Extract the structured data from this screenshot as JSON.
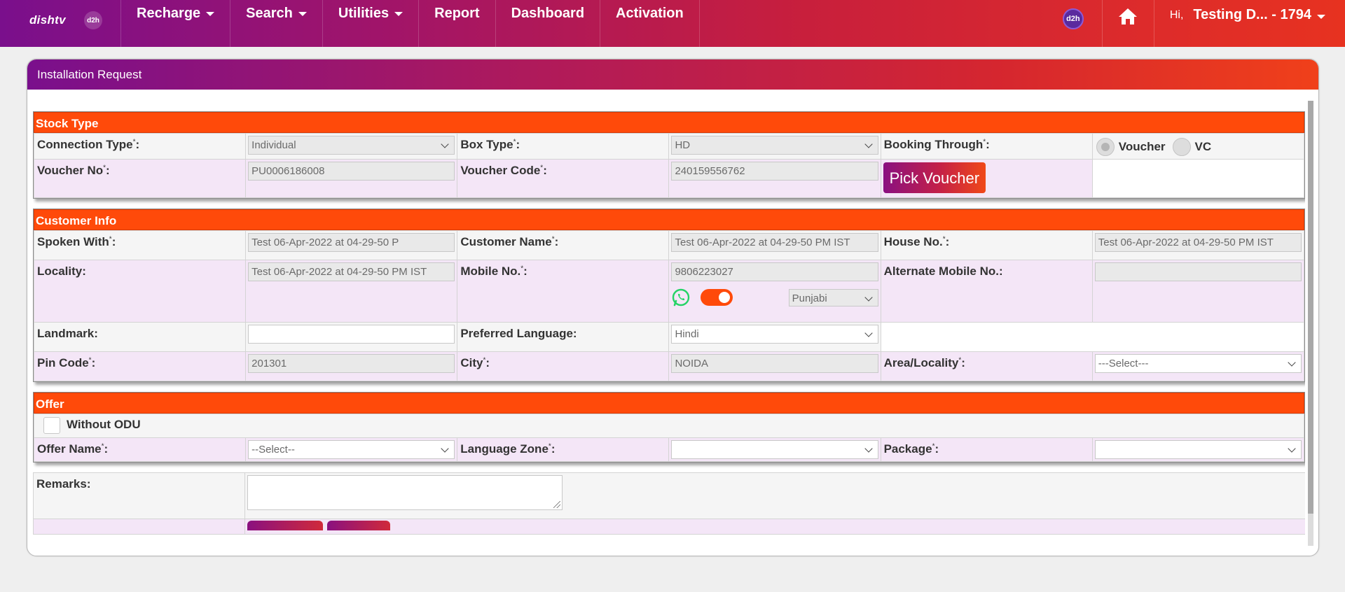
{
  "brand": {
    "logo_text": "dishtv",
    "d2h_logo_text": "d2h"
  },
  "nav": {
    "items": [
      {
        "label": "Recharge",
        "dropdown": true
      },
      {
        "label": "Search",
        "dropdown": true
      },
      {
        "label": "Utilities",
        "dropdown": true
      },
      {
        "label": "Report",
        "dropdown": false
      },
      {
        "label": "Dashboard",
        "dropdown": false
      },
      {
        "label": "Activation",
        "dropdown": false
      }
    ],
    "d2h_badge": "d2h",
    "greeting": "Hi,",
    "user_name": "Testing D... - 1794"
  },
  "panel": {
    "title": "Installation Request",
    "stock_type": {
      "title": "Stock Type",
      "connection_type_label": "Connection Type",
      "connection_type_value": "Individual",
      "box_type_label": "Box Type",
      "box_type_value": "HD",
      "booking_through_label": "Booking Through",
      "booking_options": [
        "Voucher",
        "VC"
      ],
      "voucher_no_label": "Voucher No",
      "voucher_no_value": "PU0006186008",
      "voucher_code_label": "Voucher Code",
      "voucher_code_value": "240159556762",
      "pick_voucher_label": "Pick Voucher"
    },
    "customer_info": {
      "title": "Customer Info",
      "spoken_with_label": "Spoken With",
      "spoken_with_value": "Test 06-Apr-2022 at 04-29-50 P",
      "customer_name_label": "Customer Name",
      "customer_name_value": "Test 06-Apr-2022 at 04-29-50 PM IST",
      "house_no_label": "House No.",
      "house_no_value": "Test 06-Apr-2022 at 04-29-50 PM IST",
      "locality_label": "Locality:",
      "locality_value": "Test 06-Apr-2022 at 04-29-50 PM IST",
      "mobile_no_label": "Mobile No.",
      "mobile_no_value": "9806223027",
      "whatsapp_language": "Punjabi",
      "alternate_mobile_label": "Alternate Mobile No.:",
      "alternate_mobile_value": "",
      "landmark_label": "Landmark:",
      "landmark_value": "",
      "preferred_language_label": "Preferred Language:",
      "preferred_language_value": "Hindi",
      "pin_code_label": "Pin Code",
      "pin_code_value": "201301",
      "city_label": "City",
      "city_value": "NOIDA",
      "area_locality_label": "Area/Locality",
      "area_locality_value": "---Select---"
    },
    "offer": {
      "title": "Offer",
      "without_odu_label": "Without ODU",
      "offer_name_label": "Offer Name",
      "offer_name_value": "--Select--",
      "language_zone_label": "Language Zone",
      "language_zone_value": "",
      "package_label": "Package",
      "package_value": ""
    },
    "remarks_label": "Remarks:",
    "remarks_value": ""
  },
  "colors": {
    "section_header": "#ff4a0a",
    "nav_gradient_start": "#7a0f8c",
    "nav_gradient_end": "#e73220",
    "row_pink": "#f4e6f7",
    "whatsapp": "#25d366"
  }
}
